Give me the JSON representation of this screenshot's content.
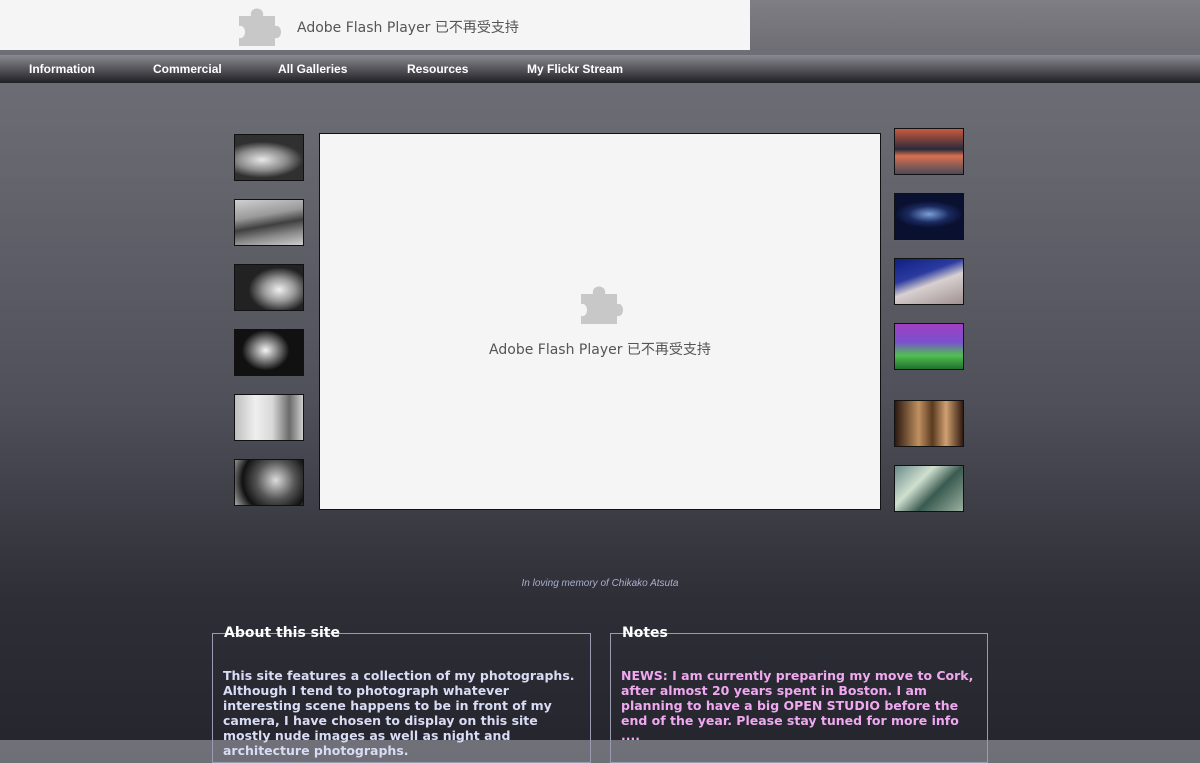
{
  "flash_notice": {
    "message": "Adobe Flash Player 已不再受支持",
    "icon": "puzzle-piece-icon"
  },
  "nav": {
    "items": [
      {
        "label": "Information"
      },
      {
        "label": "Commercial"
      },
      {
        "label": "All Galleries"
      },
      {
        "label": "Resources"
      },
      {
        "label": "My Flickr Stream"
      }
    ]
  },
  "main": {
    "flash_message": "Adobe Flash Player 已不再受支持",
    "memorial": "In loving memory of Chikako Atsuta"
  },
  "about": {
    "title": "About this site",
    "text": "This site features a collection of my photographs. Although I tend to photograph whatever interesting scene happens to be in front of my camera, I have chosen to display on this site mostly nude images as well as night and architecture photographs."
  },
  "notes": {
    "title": "Notes",
    "text": "NEWS: I am currently preparing my move to Cork, after almost 20 years spent in Boston. I am planning to have a big OPEN STUDIO before the end of the year. Please stay tuned for more info ...."
  },
  "colors": {
    "about_text": "#d8dcf4",
    "notes_text": "#f0a8f0"
  }
}
